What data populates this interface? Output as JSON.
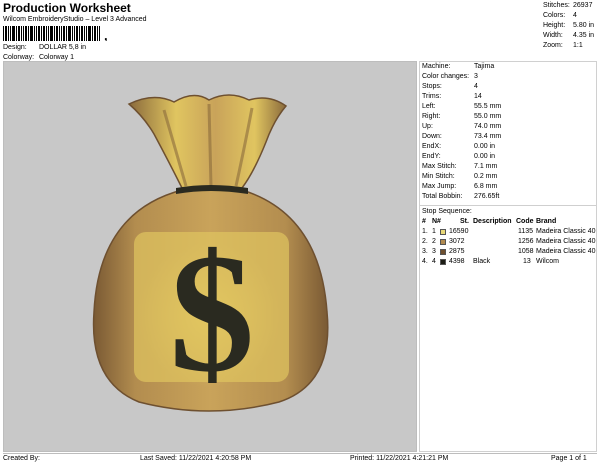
{
  "header": {
    "title": "Production Worksheet",
    "subtitle": "Wilcom EmbroideryStudio – Level 3 Advanced",
    "barcode_symbol": ","
  },
  "meta": {
    "design_label": "Design:",
    "design_value": "DOLLAR 5,8 in",
    "colorway_label": "Colorway:",
    "colorway_value": "Colorway 1"
  },
  "stats": [
    {
      "label": "Stitches:",
      "value": "26937"
    },
    {
      "label": "Colors:",
      "value": "4"
    },
    {
      "label": "Height:",
      "value": "5.80 in"
    },
    {
      "label": "Width:",
      "value": "4.35 in"
    },
    {
      "label": "Zoom:",
      "value": "1:1"
    }
  ],
  "machine_info": [
    {
      "label": "Machine:",
      "value": "Tajima"
    },
    {
      "label": "Color changes:",
      "value": "3"
    },
    {
      "label": "Stops:",
      "value": "4"
    },
    {
      "label": "Trims:",
      "value": "14"
    },
    {
      "label": "Left:",
      "value": "55.5 mm"
    },
    {
      "label": "Right:",
      "value": "55.0 mm"
    },
    {
      "label": "Up:",
      "value": "74.0 mm"
    },
    {
      "label": "Down:",
      "value": "73.4 mm"
    },
    {
      "label": "EndX:",
      "value": "0.00 in"
    },
    {
      "label": "EndY:",
      "value": "0.00 in"
    },
    {
      "label": "Max Stitch:",
      "value": "7.1 mm"
    },
    {
      "label": "Min Stitch:",
      "value": "0.2 mm"
    },
    {
      "label": "Max Jump:",
      "value": "6.8 mm"
    },
    {
      "label": "Total Bobbin:",
      "value": "276.65ft"
    }
  ],
  "stop_sequence": {
    "title": "Stop Sequence:",
    "headers": [
      "#",
      "N#",
      "St.",
      "Description",
      "Code",
      "Brand"
    ],
    "rows": [
      {
        "num": "1.",
        "n": "1",
        "color": "#e8d878",
        "stitches": "16590",
        "description": "",
        "code": "1135",
        "brand": "Madeira Classic 40"
      },
      {
        "num": "2.",
        "n": "2",
        "color": "#b08a50",
        "stitches": "3072",
        "description": "",
        "code": "1256",
        "brand": "Madeira Classic 40"
      },
      {
        "num": "3.",
        "n": "3",
        "color": "#6e5030",
        "stitches": "2875",
        "description": "",
        "code": "1058",
        "brand": "Madeira Classic 40"
      },
      {
        "num": "4.",
        "n": "4",
        "color": "#1c1c14",
        "stitches": "4398",
        "description": "Black",
        "code": "13",
        "brand": "Wilcom"
      }
    ]
  },
  "footer": {
    "created_by": "Created By:",
    "last_saved": "Last Saved: 11/22/2021 4:20:58 PM",
    "printed": "Printed: 11/22/2021 4:21:21 PM",
    "page": "Page 1 of 1"
  },
  "colors": {
    "bag_light": "#e0c560",
    "bag_mid": "#b38d4f",
    "bag_dark": "#6e5030",
    "dollar": "#2a2a20",
    "panel_bg": "#c8c8c8"
  }
}
